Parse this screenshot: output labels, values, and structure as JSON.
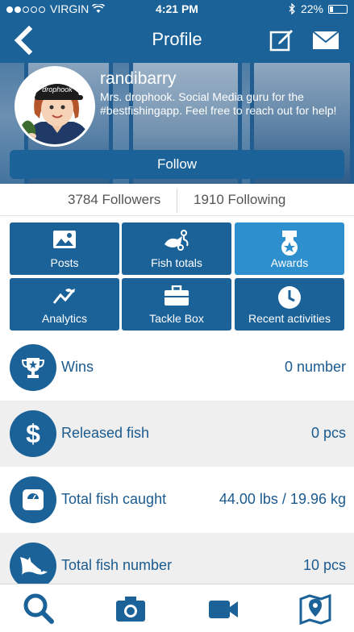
{
  "status": {
    "carrier": "VIRGIN",
    "time": "4:21 PM",
    "battery": "22%"
  },
  "header": {
    "title": "Profile"
  },
  "profile": {
    "username": "randibarry",
    "bio": "Mrs. drophook. Social Media guru for the #bestfishingapp. Feel free to reach out for help!",
    "follow_label": "Follow",
    "cap_text": "drophook",
    "followers": "3784 Followers",
    "following": "1910 Following"
  },
  "grid": [
    {
      "label": "Posts",
      "icon": "image-icon"
    },
    {
      "label": "Fish totals",
      "icon": "fish-scale-icon"
    },
    {
      "label": "Awards",
      "icon": "medal-icon"
    },
    {
      "label": "Analytics",
      "icon": "analytics-icon"
    },
    {
      "label": "Tackle Box",
      "icon": "briefcase-icon"
    },
    {
      "label": "Recent activities",
      "icon": "clock-icon"
    }
  ],
  "stats": [
    {
      "name": "Wins",
      "value": "0 number",
      "icon": "trophy-icon"
    },
    {
      "name": "Released fish",
      "value": "0 pcs",
      "icon": "dollar-icon"
    },
    {
      "name": "Total fish caught",
      "value": "44.00 lbs / 19.96 kg",
      "icon": "scale-icon"
    },
    {
      "name": "Total fish number",
      "value": "10 pcs",
      "icon": "fish-icon"
    }
  ],
  "tabs": [
    "search-icon",
    "camera-icon",
    "video-icon",
    "map-icon"
  ],
  "colors": {
    "primary": "#1b6299",
    "active": "#2e8fcf",
    "text": "#1b5a8e"
  }
}
